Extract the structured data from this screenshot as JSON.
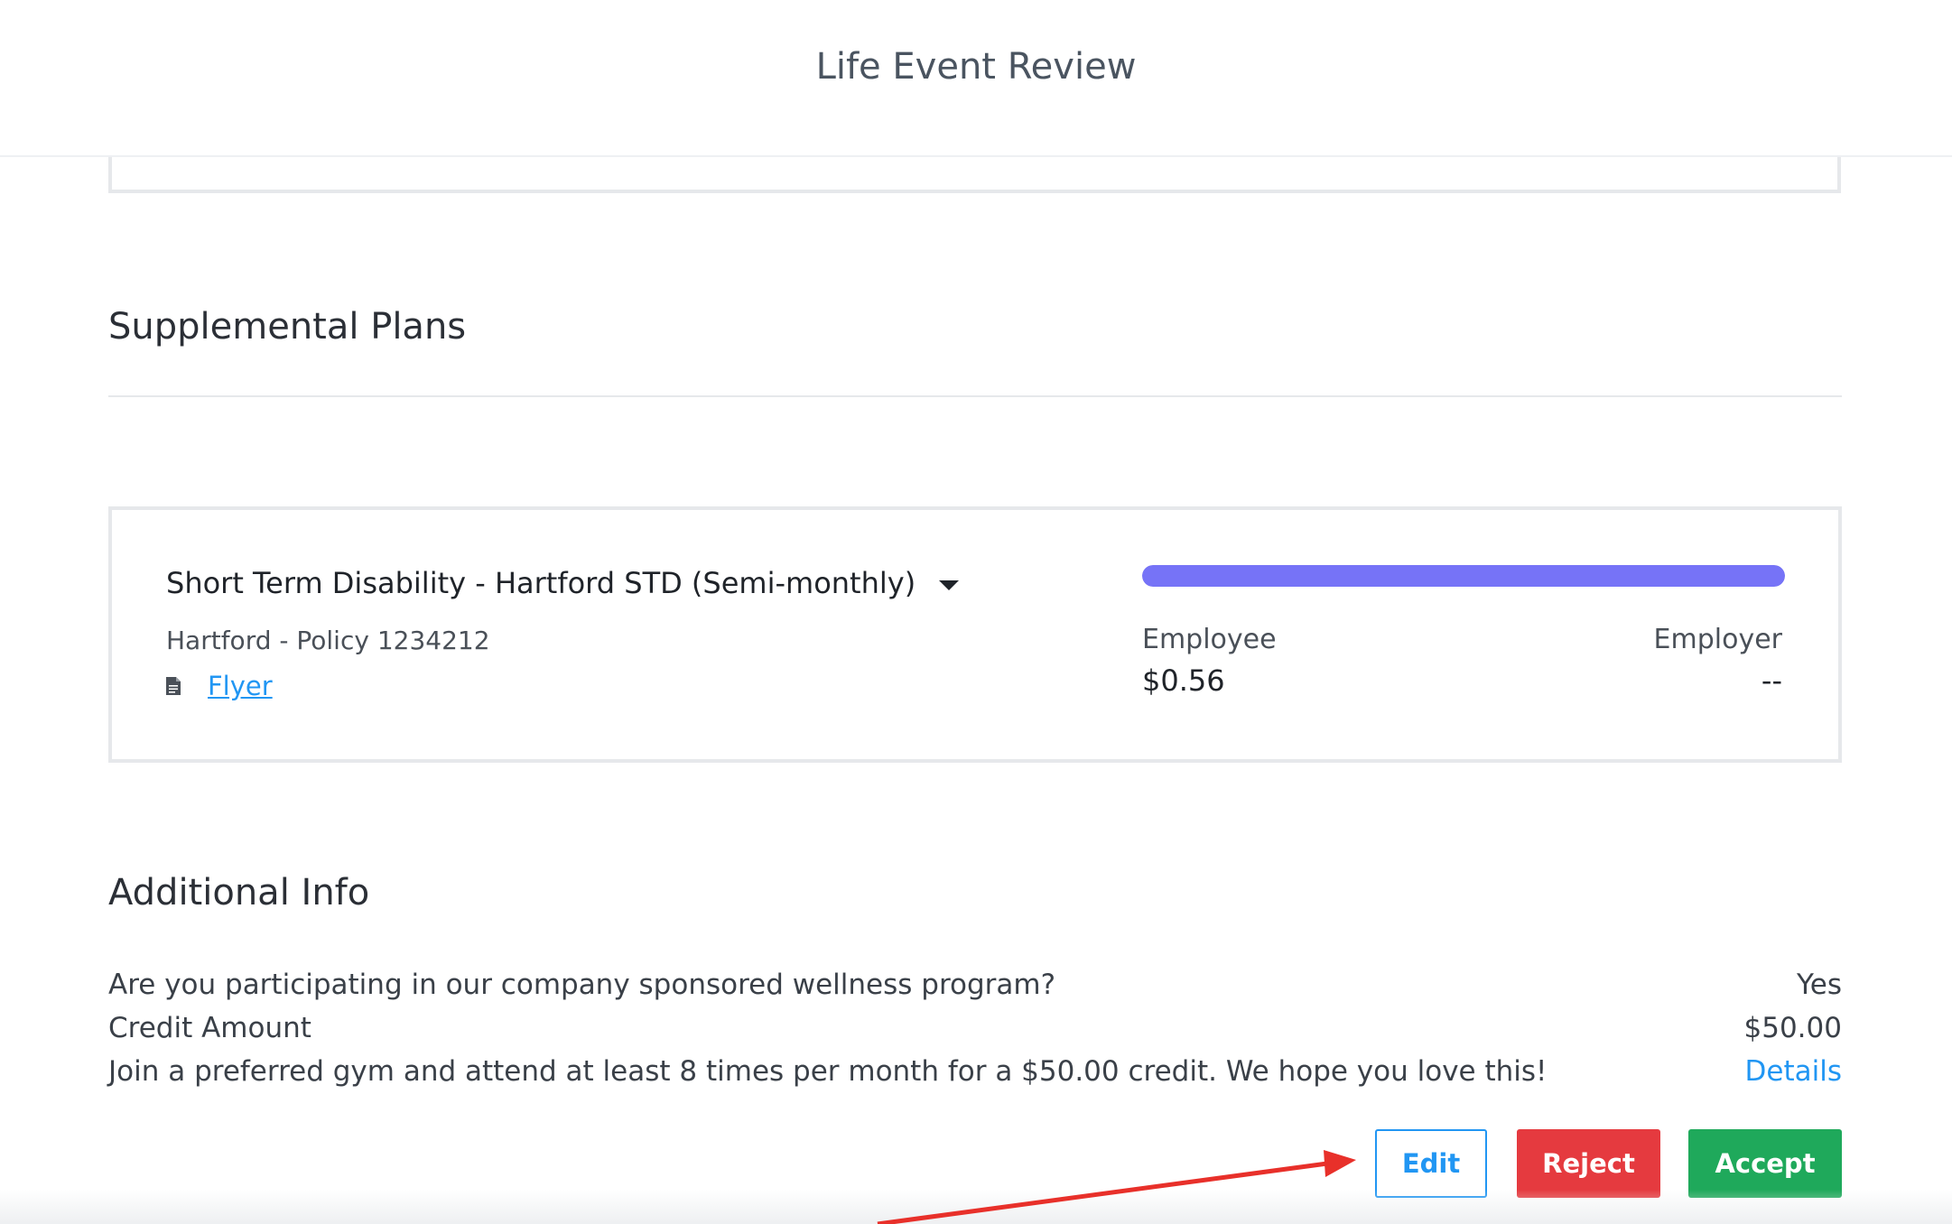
{
  "header": {
    "title": "Life Event Review"
  },
  "supplemental": {
    "title": "Supplemental Plans",
    "plan": {
      "name": "Short Term Disability - Hartford STD (Semi-monthly)",
      "carrier": "Hartford - Policy 1234212",
      "flyer_label": "Flyer",
      "employee_label": "Employee",
      "employee_amount": "$0.56",
      "employer_label": "Employer",
      "employer_amount": "--",
      "employee_share": 1.0,
      "bar_color": "#7673f7"
    }
  },
  "additional": {
    "title": "Additional Info",
    "rows": [
      {
        "label": "Are you participating in our company sponsored wellness program?",
        "value": "Yes"
      },
      {
        "label": "Credit Amount",
        "value": "$50.00"
      },
      {
        "label": "Join a preferred gym and attend at least 8 times per month for a $50.00 credit. We hope you love this!",
        "value": "Details"
      }
    ]
  },
  "actions": {
    "edit": "Edit",
    "reject": "Reject",
    "accept": "Accept"
  },
  "colors": {
    "link": "#2196f3",
    "reject": "#e53a3f",
    "accept": "#1fa95b",
    "annotation_arrow": "#e8302a"
  }
}
